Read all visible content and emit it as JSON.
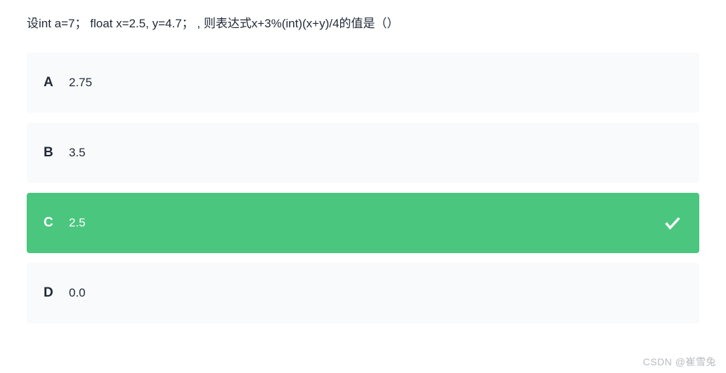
{
  "question": "设int a=7；  float x=2.5, y=4.7； , 则表达式x+3%(int)(x+y)/4的值是（）",
  "options": [
    {
      "letter": "A",
      "text": "2.75",
      "correct": false
    },
    {
      "letter": "B",
      "text": "3.5",
      "correct": false
    },
    {
      "letter": "C",
      "text": "2.5",
      "correct": true
    },
    {
      "letter": "D",
      "text": "0.0",
      "correct": false
    }
  ],
  "watermark": "CSDN @崔雪兔"
}
